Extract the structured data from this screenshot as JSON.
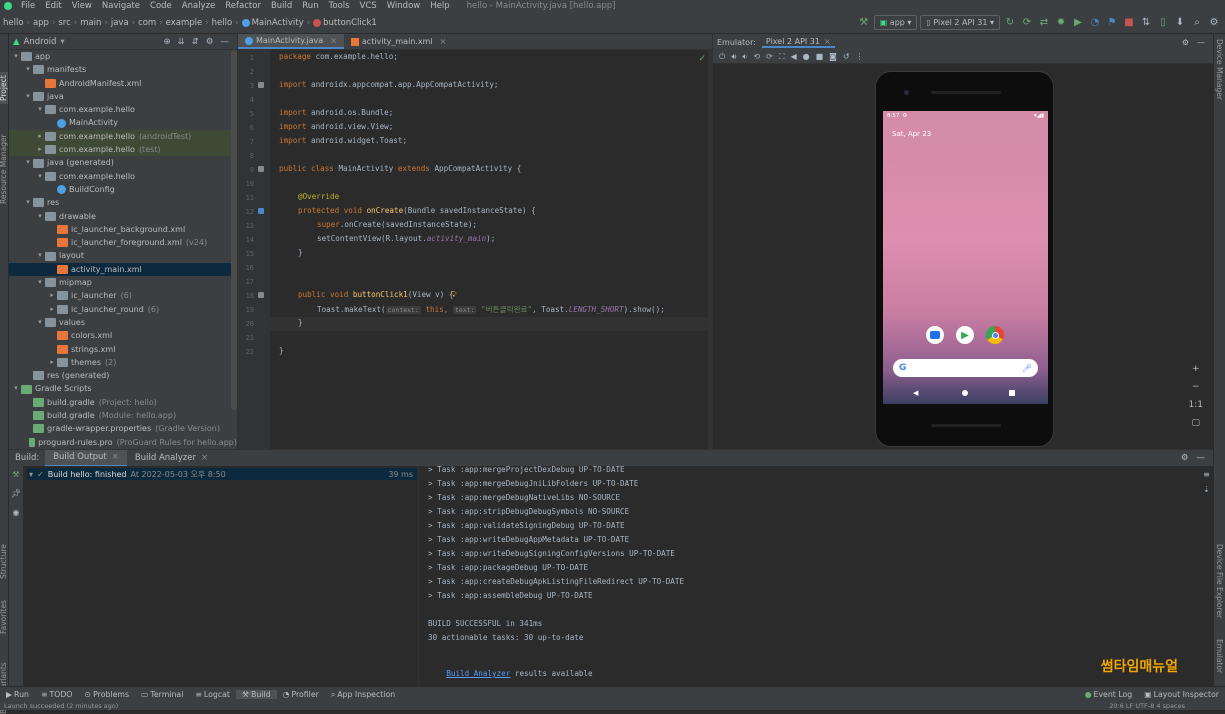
{
  "menu": [
    "File",
    "Edit",
    "View",
    "Navigate",
    "Code",
    "Analyze",
    "Refactor",
    "Build",
    "Run",
    "Tools",
    "VCS",
    "Window",
    "Help"
  ],
  "window_title": "hello - MainActivity.java [hello.app]",
  "breadcrumb": [
    "hello",
    "app",
    "src",
    "main",
    "java",
    "com",
    "example",
    "hello",
    "MainActivity",
    "buttonClick1"
  ],
  "toolbar": {
    "run_config": "app",
    "device": "Pixel 2 API 31"
  },
  "left_strip": {
    "project": "Project",
    "resource_manager": "Resource Manager",
    "structure": "Structure",
    "favorites": "Favorites",
    "build_variants": "Build Variants"
  },
  "right_strip": {
    "device_manager": "Device Manager",
    "device_file_explorer": "Device File Explorer",
    "emulator": "Emulator"
  },
  "project_panel": {
    "view_mode": "Android",
    "tree": [
      {
        "label": "app",
        "level": 0,
        "type": "folder",
        "arrow": "▾"
      },
      {
        "label": "manifests",
        "level": 1,
        "type": "folder",
        "arrow": "▾"
      },
      {
        "label": "AndroidManifest.xml",
        "level": 2,
        "type": "xml"
      },
      {
        "label": "java",
        "level": 1,
        "type": "folder",
        "arrow": "▾"
      },
      {
        "label": "com.example.hello",
        "level": 2,
        "type": "folder",
        "arrow": "▾"
      },
      {
        "label": "MainActivity",
        "level": 3,
        "type": "java"
      },
      {
        "label": "com.example.hello",
        "suffix": "(androidTest)",
        "level": 2,
        "type": "folder",
        "arrow": "▸",
        "hl": true
      },
      {
        "label": "com.example.hello",
        "suffix": "(test)",
        "level": 2,
        "type": "folder",
        "arrow": "▸",
        "hl": true
      },
      {
        "label": "java (generated)",
        "level": 1,
        "type": "folder",
        "arrow": "▾"
      },
      {
        "label": "com.example.hello",
        "level": 2,
        "type": "folder",
        "arrow": "▾"
      },
      {
        "label": "BuildConfig",
        "level": 3,
        "type": "java"
      },
      {
        "label": "res",
        "level": 1,
        "type": "folder",
        "arrow": "▾"
      },
      {
        "label": "drawable",
        "level": 2,
        "type": "folder",
        "arrow": "▾"
      },
      {
        "label": "ic_launcher_background.xml",
        "level": 3,
        "type": "xml"
      },
      {
        "label": "ic_launcher_foreground.xml",
        "suffix": "(v24)",
        "level": 3,
        "type": "xml"
      },
      {
        "label": "layout",
        "level": 2,
        "type": "folder",
        "arrow": "▾"
      },
      {
        "label": "activity_main.xml",
        "level": 3,
        "type": "xml",
        "sel": true
      },
      {
        "label": "mipmap",
        "level": 2,
        "type": "folder",
        "arrow": "▾"
      },
      {
        "label": "ic_launcher",
        "suffix": "(6)",
        "level": 3,
        "type": "folder",
        "arrow": "▸"
      },
      {
        "label": "ic_launcher_round",
        "suffix": "(6)",
        "level": 3,
        "type": "folder",
        "arrow": "▸"
      },
      {
        "label": "values",
        "level": 2,
        "type": "folder",
        "arrow": "▾"
      },
      {
        "label": "colors.xml",
        "level": 3,
        "type": "xml"
      },
      {
        "label": "strings.xml",
        "level": 3,
        "type": "xml"
      },
      {
        "label": "themes",
        "suffix": "(2)",
        "level": 3,
        "type": "folder",
        "arrow": "▸"
      },
      {
        "label": "res (generated)",
        "level": 1,
        "type": "folder"
      },
      {
        "label": "Gradle Scripts",
        "level": 0,
        "type": "gradle",
        "arrow": "▾"
      },
      {
        "label": "build.gradle",
        "suffix": "(Project: hello)",
        "level": 1,
        "type": "gradle"
      },
      {
        "label": "build.gradle",
        "suffix": "(Module: hello.app)",
        "level": 1,
        "type": "gradle"
      },
      {
        "label": "gradle-wrapper.properties",
        "suffix": "(Gradle Version)",
        "level": 1,
        "type": "gradle"
      },
      {
        "label": "proguard-rules.pro",
        "suffix": "(ProGuard Rules for hello.app)",
        "level": 1,
        "type": "gradle"
      }
    ]
  },
  "editor": {
    "tabs": [
      {
        "label": "MainActivity.java",
        "active": true
      },
      {
        "label": "activity_main.xml",
        "active": false
      }
    ],
    "line_numbers": [
      "1",
      "2",
      "3",
      "4",
      "5",
      "6",
      "7",
      "8",
      "9",
      "10",
      "11",
      "12",
      "13",
      "14",
      "15",
      "16",
      "17",
      "18",
      "19",
      "20",
      "21",
      "22"
    ],
    "code": {
      "l1_kw": "package ",
      "l1": "com.example.hello;",
      "l3_kw": "import ",
      "l3": "androidx.appcompat.app.AppCompatActivity;",
      "l5_kw": "import ",
      "l5": "android.os.Bundle;",
      "l6_kw": "import ",
      "l6": "android.view.View;",
      "l7_kw": "import ",
      "l7": "android.widget.Toast;",
      "l9_kw": "public class ",
      "l9a": "MainActivity ",
      "l9_kw2": "extends ",
      "l9b": "AppCompatActivity {",
      "l11": "@Override",
      "l12_kw": "protected void ",
      "l12_fn": "onCreate",
      "l12": "(Bundle savedInstanceState) {",
      "l13_kw": "super",
      ".": "",
      "l13": ".onCreate(savedInstanceState);",
      "l14": "setContentView(R.layout.",
      "l14_f": "activity_main",
      "l14b": ");",
      "l15": "}",
      "l18_kw": "public void ",
      "l18_fn": "buttonClick1",
      "l18": "(View v) {",
      "l19a": "Toast.makeText(",
      "l19_h1": "context:",
      "l19_kw": " this, ",
      "l19_h2": "text:",
      "l19_s": " \"버튼클릭완료\"",
      "l19b": ", Toast.",
      "l19_f": "LENGTH_SHORT",
      "l19c": ").show();",
      "l20": "}",
      "l22": "}"
    }
  },
  "emulator": {
    "label": "Emulator:",
    "device_tab": "Pixel 2 API 31",
    "phone": {
      "time": "8:57",
      "date": "Sat, Apr 23"
    }
  },
  "build": {
    "label": "Build:",
    "tabs": [
      "Build Output",
      "Build Analyzer"
    ],
    "result": "Build hello: finished",
    "result_time": "At 2022-05-03 오후 8:50",
    "duration": "39 ms",
    "console": [
      "> Task :app:mergeProjectDexDebug UP-TO-DATE",
      "> Task :app:mergeDebugJniLibFolders UP-TO-DATE",
      "> Task :app:mergeDebugNativeLibs NO-SOURCE",
      "> Task :app:stripDebugDebugSymbols NO-SOURCE",
      "> Task :app:validateSigningDebug UP-TO-DATE",
      "> Task :app:writeDebugAppMetadata UP-TO-DATE",
      "> Task :app:writeDebugSigningConfigVersions UP-TO-DATE",
      "> Task :app:packageDebug UP-TO-DATE",
      "> Task :app:createDebugApkListingFileRedirect UP-TO-DATE",
      "> Task :app:assembleDebug UP-TO-DATE",
      "",
      "BUILD SUCCESSFUL in 341ms",
      "30 actionable tasks: 30 up-to-date"
    ],
    "analyzer_link": "Build Analyzer",
    "analyzer_suffix": " results available"
  },
  "watermark": "썸타임매뉴얼",
  "bottom_tabs": [
    "Run",
    "TODO",
    "Problems",
    "Terminal",
    "Logcat",
    "Build",
    "Profiler",
    "App Inspection"
  ],
  "bottom_right": [
    "Event Log",
    "Layout Inspector"
  ],
  "status_text": "Launch succeeded (2 minutes ago)",
  "status_right": "20:6   LF   UTF-8   4 spaces",
  "colors": {
    "accent": "#4a88c7",
    "selection": "#0d293e",
    "panel": "#3c3f41",
    "editor_bg": "#2b2b2b",
    "watermark": "#f0a500"
  }
}
